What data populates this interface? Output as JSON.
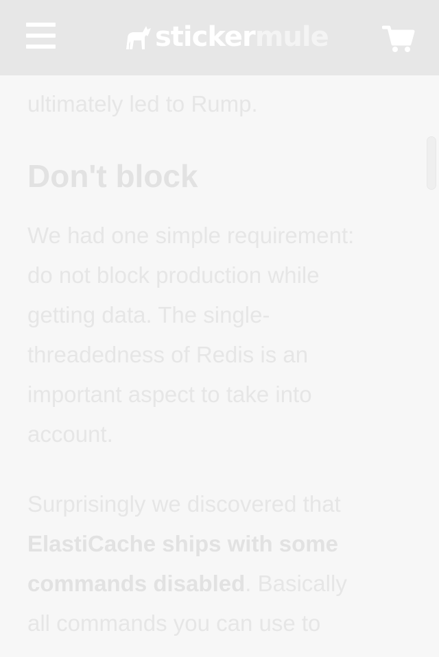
{
  "header": {
    "logo_word1": "sticker",
    "logo_word2": "mule",
    "menu_icon": "hamburger-menu-icon",
    "cart_icon": "shopping-cart-icon",
    "logo_icon": "mule-icon",
    "background": "#e7e7e7",
    "icon_color": "#ffffff"
  },
  "article": {
    "lead_fragment": "ultimately led to Rump.",
    "heading": "Don't block",
    "paragraph1_lines": [
      "We had one simple requirement:",
      "do not block production while",
      "getting data. The single-",
      "threadedness of Redis is an",
      "important aspect to take into",
      "account."
    ],
    "paragraph2": {
      "line1": "Surprisingly we discovered that",
      "bold_line1": "ElastiCache ships with some",
      "bold_line2": "commands disabled",
      "line3_rest": ". Basically",
      "line4": "all commands you can use to"
    },
    "text_color": "#e6e6e6"
  }
}
